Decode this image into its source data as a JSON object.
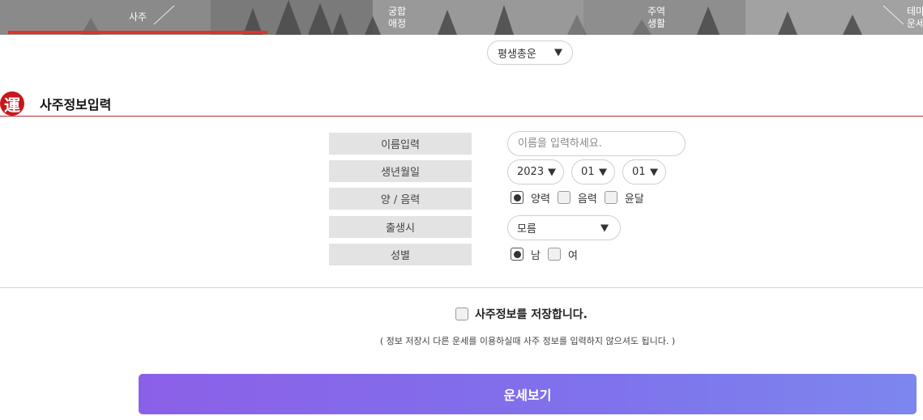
{
  "nav": {
    "tabs": [
      {
        "lines": [
          "사주"
        ]
      },
      {
        "lines": [
          "궁합",
          "애정"
        ]
      },
      {
        "lines": [
          "주역",
          "생활"
        ]
      },
      {
        "lines": [
          "테마",
          "운세"
        ]
      }
    ]
  },
  "top_select": {
    "value": "평생총운"
  },
  "section": {
    "seal": "運",
    "title": "사주정보입력"
  },
  "form": {
    "name": {
      "label": "이름입력",
      "placeholder": "이름을 입력하세요."
    },
    "birth": {
      "label": "생년월일",
      "year": "2023",
      "month": "01",
      "day": "01"
    },
    "calendar": {
      "label": "양 / 음력",
      "options": [
        "양력",
        "음력",
        "윤달"
      ],
      "selected": "양력"
    },
    "time": {
      "label": "출생시",
      "value": "모름"
    },
    "gender": {
      "label": "성별",
      "options": [
        "남",
        "여"
      ],
      "selected": "남"
    }
  },
  "save": {
    "label": "사주정보를 저장합니다.",
    "note": "( 정보 저장시 다른 운세를 이용하실때 사주 정보를 입력하지 않으셔도 됩니다. )"
  },
  "submit": {
    "label": "운세보기"
  },
  "colors": {
    "active_tab": "#e0312a",
    "seal": "#c8161d",
    "button_start": "#8b60e8",
    "button_end": "#7d86ee"
  }
}
